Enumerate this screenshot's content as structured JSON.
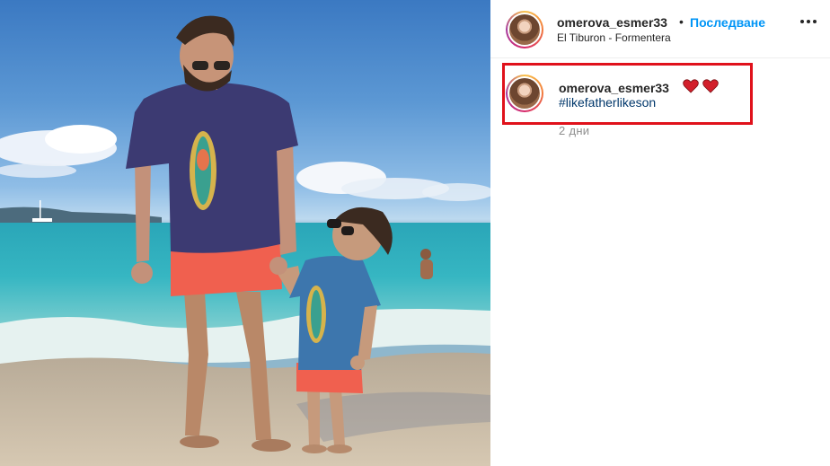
{
  "post": {
    "photo_icon": "beach-photo",
    "header": {
      "username": "omerova_esmer33",
      "separator": "•",
      "follow_label": "Последване",
      "location": "El Tiburon - Formentera",
      "more_icon": "more-options-icon"
    },
    "caption": {
      "username": "omerova_esmer33",
      "emoji": "heart-icon",
      "hashtag": "#likefatherlikeson",
      "time": "2 дни"
    }
  },
  "colors": {
    "link_blue": "#0095f6",
    "hashtag_blue": "#00376b",
    "highlight_red": "#e0111b",
    "heart_red": "#d21f2b"
  }
}
